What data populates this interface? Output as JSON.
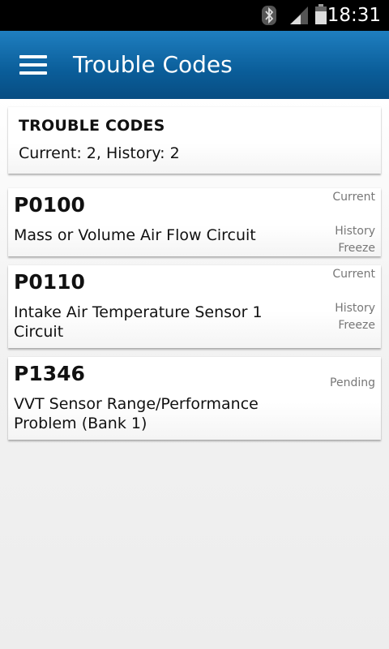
{
  "status_bar": {
    "time": "18:31",
    "icons": [
      "bluetooth-icon",
      "signal-icon",
      "battery-icon"
    ]
  },
  "app_bar": {
    "title": "Trouble Codes",
    "menu_icon": "hamburger-menu-icon",
    "color": "#0a5d99"
  },
  "summary": {
    "title": "TROUBLE CODES",
    "line": "Current: 2, History: 2"
  },
  "codes": [
    {
      "code": "P0100",
      "description": "Mass or Volume Air Flow Circuit",
      "flags": [
        "Current",
        "History",
        "Freeze"
      ]
    },
    {
      "code": "P0110",
      "description": "Intake Air Temperature Sensor 1 Circuit",
      "flags": [
        "Current",
        "History",
        "Freeze"
      ]
    },
    {
      "code": "P1346",
      "description": "VVT Sensor Range/Performance Problem (Bank 1)",
      "flags": [
        "Pending"
      ]
    }
  ]
}
